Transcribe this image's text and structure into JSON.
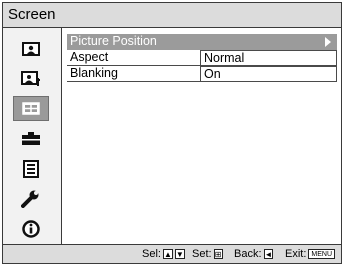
{
  "window": {
    "title": "Screen"
  },
  "sidebar": {
    "items": [
      {
        "name": "picture-icon",
        "active": false
      },
      {
        "name": "picture-adjust-icon",
        "active": false
      },
      {
        "name": "screen-icon",
        "active": true
      },
      {
        "name": "setup-icon",
        "active": false
      },
      {
        "name": "menu-list-icon",
        "active": false
      },
      {
        "name": "wrench-icon",
        "active": false
      },
      {
        "name": "info-icon",
        "active": false
      }
    ]
  },
  "menu": {
    "selected": {
      "label": "Picture Position"
    },
    "items": [
      {
        "label": "Aspect",
        "value": "Normal"
      },
      {
        "label": "Blanking",
        "value": "On"
      }
    ]
  },
  "status": {
    "sel_label": "Sel:",
    "sel_keys": [
      "▲",
      "▼"
    ],
    "set_label": "Set:",
    "set_key": "⊞",
    "back_label": "Back:",
    "back_key": "◄",
    "exit_label": "Exit:",
    "exit_key": "MENU"
  },
  "colors": {
    "selected_bg": "#9b9b9b",
    "bar_bg": "#dcdcdc",
    "active_tab_bg": "#9a9a9a"
  }
}
